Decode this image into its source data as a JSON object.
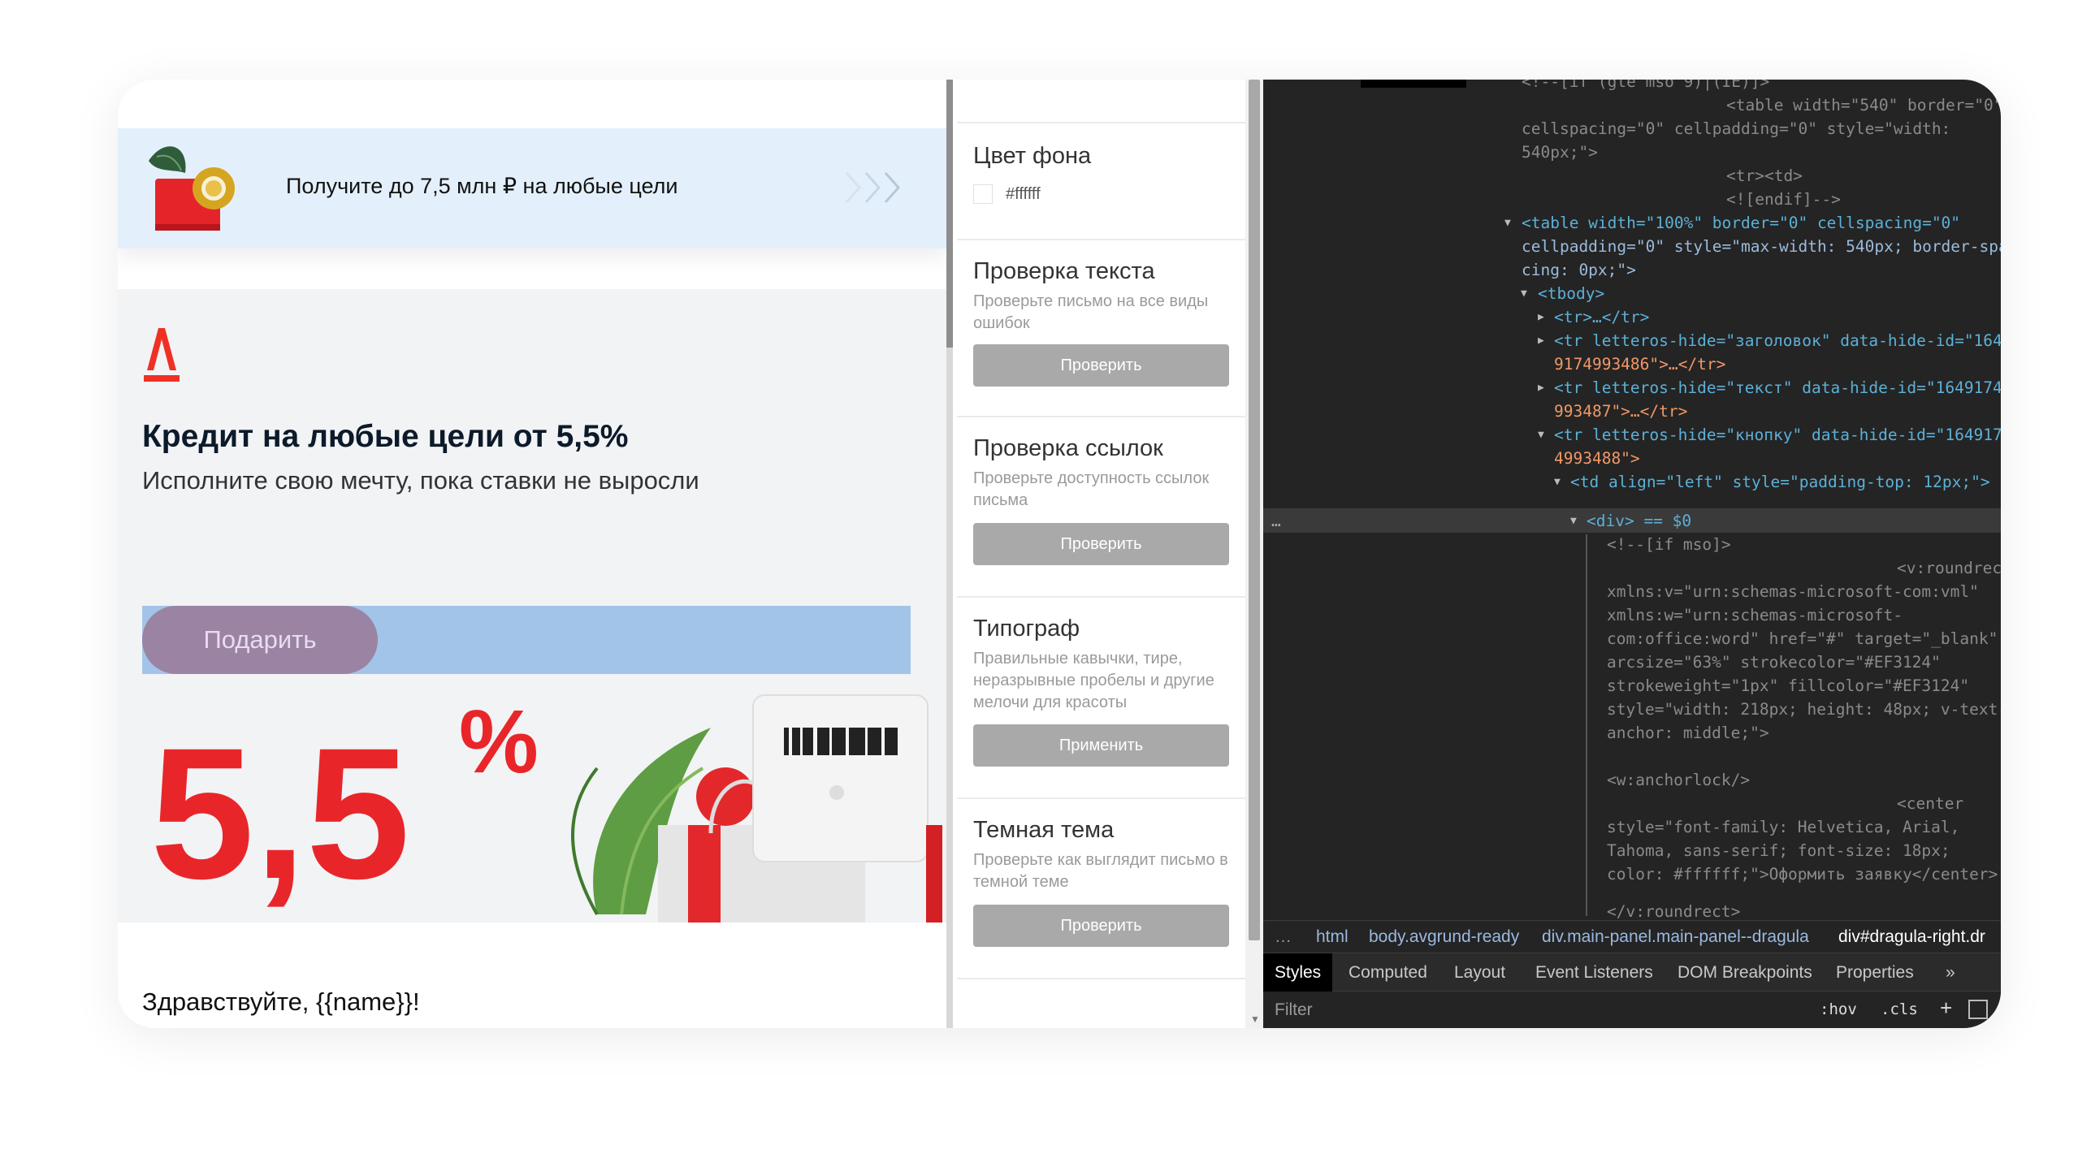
{
  "email": {
    "banner_text": "Получите до 7,5 млн ₽ на любые цели",
    "headline": "Кредит на любые цели от 5,5%",
    "subline": "Исполните свою мечту, пока ставки не выросли",
    "cta_label": "Подарить",
    "rate_big": "5,5",
    "rate_percent": "%",
    "greeting": "Здравствуйте, {{name}}!"
  },
  "tools": {
    "background": {
      "title": "Цвет фона",
      "value": "#ffffff"
    },
    "sections": [
      {
        "title": "Проверка текста",
        "desc": "Проверьте письмо на все виды ошибок",
        "button": "Проверить"
      },
      {
        "title": "Проверка ссылок",
        "desc": "Проверьте доступность ссылок письма",
        "button": "Проверить"
      },
      {
        "title": "Типограф",
        "desc": "Правильные кавычки, тире, неразрывные пробелы и другие мелочи для красоты",
        "button": "Применить"
      },
      {
        "title": "Темная тема",
        "desc": "Проверьте как выглядит письмо в темной теме",
        "button": "Проверить"
      }
    ]
  },
  "devtools": {
    "code_lines": [
      "<!--[if (gte mso 9)|(IE)]>",
      "<table width=\"540\" border=\"0\"",
      "cellspacing=\"0\" cellpadding=\"0\" style=\"width:",
      "540px;\">",
      "<tr><td>",
      "<![endif]-->",
      "<table width=\"100%\" border=\"0\" cellspacing=\"0\"",
      "cellpadding=\"0\" style=\"max-width: 540px; border-spa",
      "cing: 0px;\">",
      "<tbody>",
      "<tr>…</tr>",
      "<tr letteros-hide=\"заголовок\" data-hide-id=\"164",
      "9174993486\">…</tr>",
      "<tr letteros-hide=\"текст\" data-hide-id=\"1649174",
      "993487\">…</tr>",
      "<tr letteros-hide=\"кнопку\" data-hide-id=\"164917",
      "4993488\">",
      "<td align=\"left\" style=\"padding-top: 12px;\">",
      "<div> == $0",
      "<!--[if mso]>",
      "<v:roundrect",
      "xmlns:v=\"urn:schemas-microsoft-com:vml\"",
      "xmlns:w=\"urn:schemas-microsoft-",
      "com:office:word\" href=\"#\" target=\"_blank\"",
      "arcsize=\"63%\" strokecolor=\"#EF3124\"",
      "strokeweight=\"1px\" fillcolor=\"#EF3124\"",
      "style=\"width: 218px; height: 48px; v-text-",
      "anchor: middle;\">",
      "<w:anchorlock/>",
      "<center",
      "style=\"font-family: Helvetica, Arial,",
      "Tahoma, sans-serif; font-size: 18px;",
      "color: #ffffff;\">Оформить заявку</center>",
      "</v:roundrect>"
    ],
    "breadcrumbs": [
      "…",
      "html",
      "body.avgrund-ready",
      "div.main-panel.main-panel--dragula",
      "div#dragula-right.dr"
    ],
    "tabs": [
      "Styles",
      "Computed",
      "Layout",
      "Event Listeners",
      "DOM Breakpoints",
      "Properties",
      "»"
    ],
    "filter_placeholder": "Filter",
    "filter_tools": [
      ":hov",
      ".cls",
      "+"
    ],
    "row_marker": "…"
  },
  "colors": {
    "brand_red": "#EF3124",
    "banner_bg": "#e3f0fc",
    "button_bar": "#a2c4e8",
    "cta": "#9a83a3",
    "devtools_bg": "#242424"
  }
}
